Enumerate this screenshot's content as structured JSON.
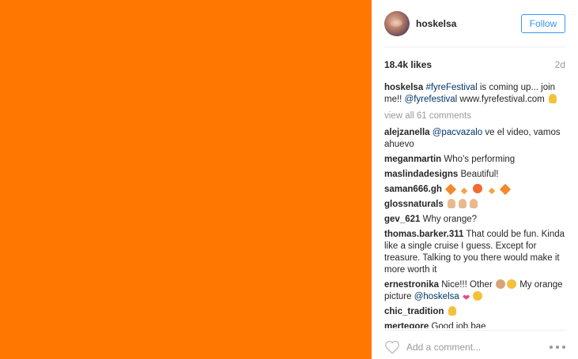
{
  "media": {
    "color": "#ff7700"
  },
  "header": {
    "username": "hoskelsa",
    "follow_label": "Follow"
  },
  "stats": {
    "likes": "18.4k likes",
    "time": "2d"
  },
  "caption": {
    "user": "hoskelsa",
    "hashtag": "#fyreFestival",
    "text1": " is coming up... join me!! ",
    "mention": "@fyrefestival",
    "text2": " www.fyrefestival.com ",
    "icon": "hand-horns-icon"
  },
  "view_all": "view all 61 comments",
  "comments": [
    {
      "user": "alejzanella",
      "mention": "@pacvazalo",
      "text": " ve el video, vamos ahuevo"
    },
    {
      "user": "meganmartin",
      "text": "Who's performing"
    },
    {
      "user": "maslindadesigns",
      "text": "Beautiful!"
    },
    {
      "user": "saman666.gh",
      "icons": [
        "orange-diamond-icon",
        "small-diamond-icon",
        "face-icon",
        "small-diamond-icon",
        "orange-diamond-icon"
      ]
    },
    {
      "user": "glossnaturals",
      "icons": [
        "ok-hand-icon",
        "ok-hand-icon",
        "ok-hand-icon"
      ]
    },
    {
      "user": "gev_621",
      "text": "Why orange?"
    },
    {
      "user": "thomas.barker.311",
      "text": "That could be fun. Kinda like a single cruise I guess. Except for treasure. Talking to you there would make it more worth it"
    },
    {
      "user": "ernestronika",
      "text1": "Nice!!! Other",
      "text2": " My orange picture ",
      "mention": "@hoskelsa"
    },
    {
      "user": "chic_tradition",
      "icons": [
        "ok-hand-icon"
      ]
    },
    {
      "user": "mertegore",
      "text": "Good job bae"
    }
  ],
  "footer": {
    "placeholder": "Add a comment..."
  }
}
